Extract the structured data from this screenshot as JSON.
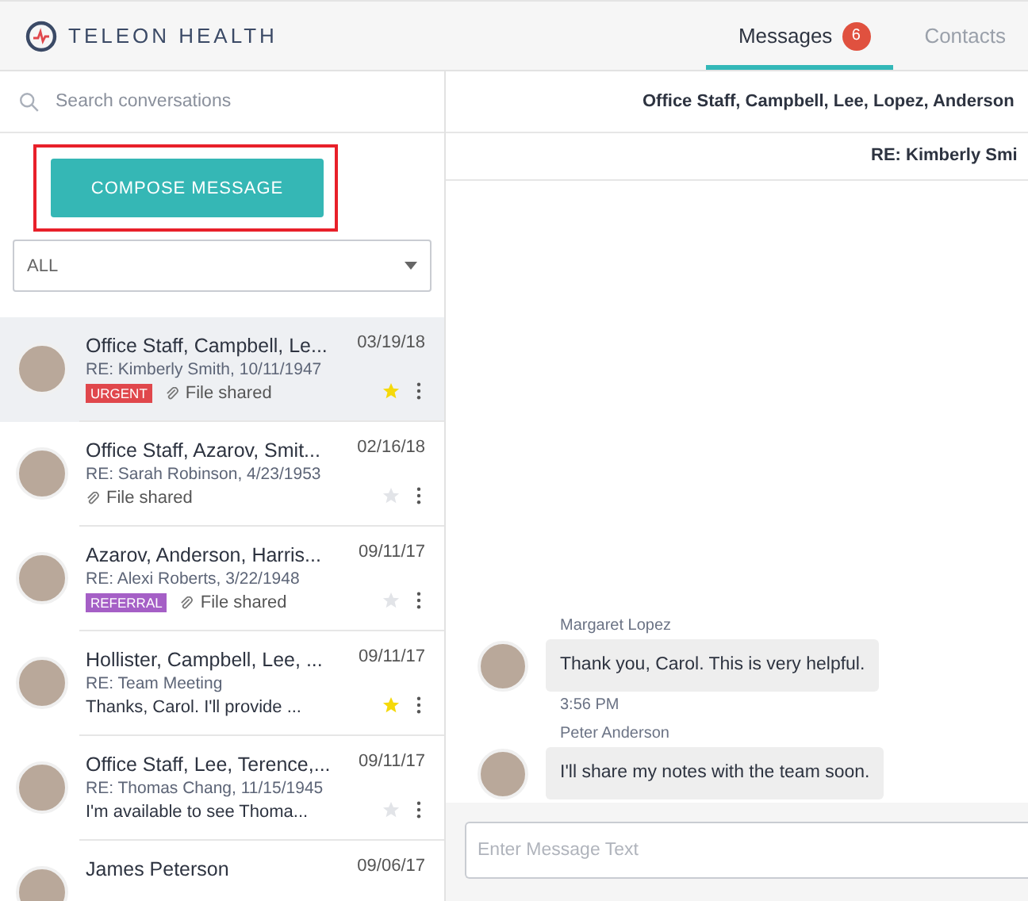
{
  "brand": {
    "name": "TELEON HEALTH"
  },
  "tabs": [
    {
      "label": "Messages",
      "badge": "6",
      "selected": true
    },
    {
      "label": "Contacts",
      "selected": false
    }
  ],
  "search": {
    "placeholder": "Search conversations"
  },
  "compose": {
    "label": "COMPOSE MESSAGE",
    "highlighted": true
  },
  "filter": {
    "value": "ALL"
  },
  "conversations": [
    {
      "title": "Office Staff, Campbell, Le...",
      "subject": "RE: Kimberly Smith, 10/11/1947",
      "tag": {
        "label": "URGENT",
        "color": "#e0474c"
      },
      "attachment": "File shared",
      "date": "03/19/18",
      "starred": true,
      "selected": true
    },
    {
      "title": "Office Staff, Azarov, Smit...",
      "subject": "RE: Sarah Robinson, 4/23/1953",
      "attachment": "File shared",
      "date": "02/16/18",
      "starred": false,
      "selected": false
    },
    {
      "title": "Azarov, Anderson, Harris...",
      "subject": "RE: Alexi Roberts, 3/22/1948",
      "tag": {
        "label": "REFERRAL",
        "color": "#a55fc6"
      },
      "attachment": "File shared",
      "date": "09/11/17",
      "starred": false,
      "selected": false
    },
    {
      "title": "Hollister, Campbell, Lee, ...",
      "subject": "RE: Team Meeting",
      "preview": "Thanks, Carol. I'll provide ...",
      "date": "09/11/17",
      "starred": true,
      "selected": false
    },
    {
      "title": "Office Staff, Lee, Terence,...",
      "subject": "RE: Thomas Chang, 11/15/1945",
      "preview": "I'm available to see Thoma...",
      "date": "09/11/17",
      "starred": false,
      "selected": false
    },
    {
      "title": "James Peterson",
      "date": "09/06/17",
      "selected": false
    }
  ],
  "thread": {
    "participants": "Office Staff, Campbell, Lee, Lopez, Anderson",
    "subject": "RE: Kimberly Smi",
    "messages": [
      {
        "sender": "Margaret Lopez",
        "text": "Thank you, Carol. This is very helpful.",
        "time": "3:56 PM"
      },
      {
        "sender": "Peter Anderson",
        "text": "I'll share my notes with the team soon."
      }
    ]
  },
  "composer": {
    "placeholder": "Enter Message Text"
  }
}
